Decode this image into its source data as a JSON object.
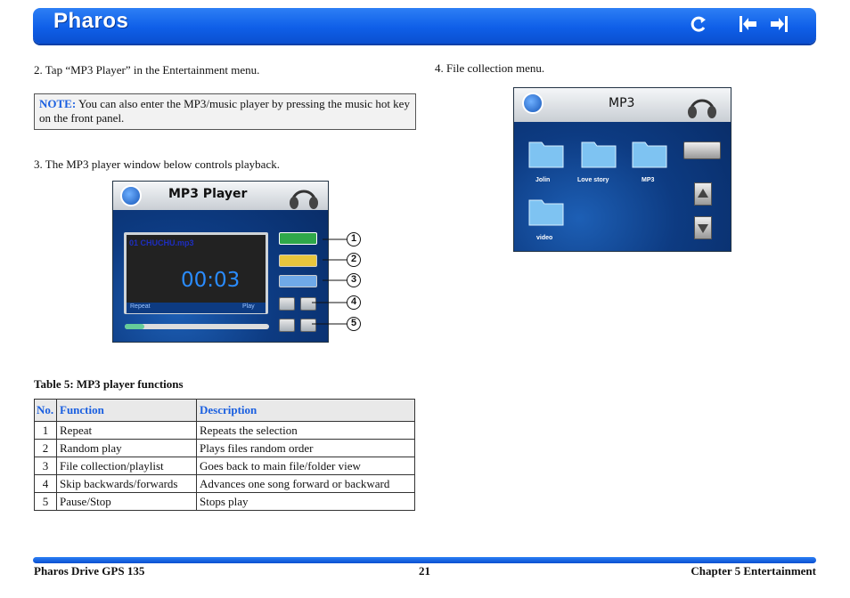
{
  "header": {
    "title": "Pharos",
    "icons": [
      "back-arrow-icon",
      "prev-page-icon",
      "next-page-icon"
    ]
  },
  "steps": {
    "s2": "2.   Tap “MP3 Player” in the Entertainment menu.",
    "s3": "3.   The MP3 player window below controls playback.",
    "s4": "4.   File collection menu."
  },
  "note": {
    "label": "NOTE:",
    "text": " You can also enter the MP3/music player by pressing the music hot key on the front panel."
  },
  "player": {
    "title": "MP3 Player",
    "track": "01   CHUCHU.mp3",
    "time": "00:03",
    "mode": "Repeat",
    "state": "Play",
    "callouts": [
      "1",
      "2",
      "3",
      "4",
      "5"
    ]
  },
  "filemenu": {
    "title": "MP3",
    "folders": [
      "Jolin",
      "Love story",
      "MP3",
      "video"
    ]
  },
  "table": {
    "caption": "Table 5: MP3 player functions",
    "headers": [
      "No.",
      "Function",
      "Description"
    ],
    "rows": [
      {
        "no": "1",
        "function": "Repeat",
        "description": "Repeats the selection"
      },
      {
        "no": "2",
        "function": "Random play",
        "description": "Plays files random order"
      },
      {
        "no": "3",
        "function": "File collection/playlist",
        "description": "Goes back to main file/folder view"
      },
      {
        "no": "4",
        "function": "Skip backwards/forwards",
        "description": "Advances one song forward or backward"
      },
      {
        "no": "5",
        "function": "Pause/Stop",
        "description": "Stops play"
      }
    ]
  },
  "footer": {
    "left": "Pharos Drive GPS 135",
    "center": "21",
    "right": "Chapter 5 Entertainment"
  },
  "colors": {
    "brand_blue": "#0f5fe8",
    "note_label": "#1a5fe0"
  }
}
